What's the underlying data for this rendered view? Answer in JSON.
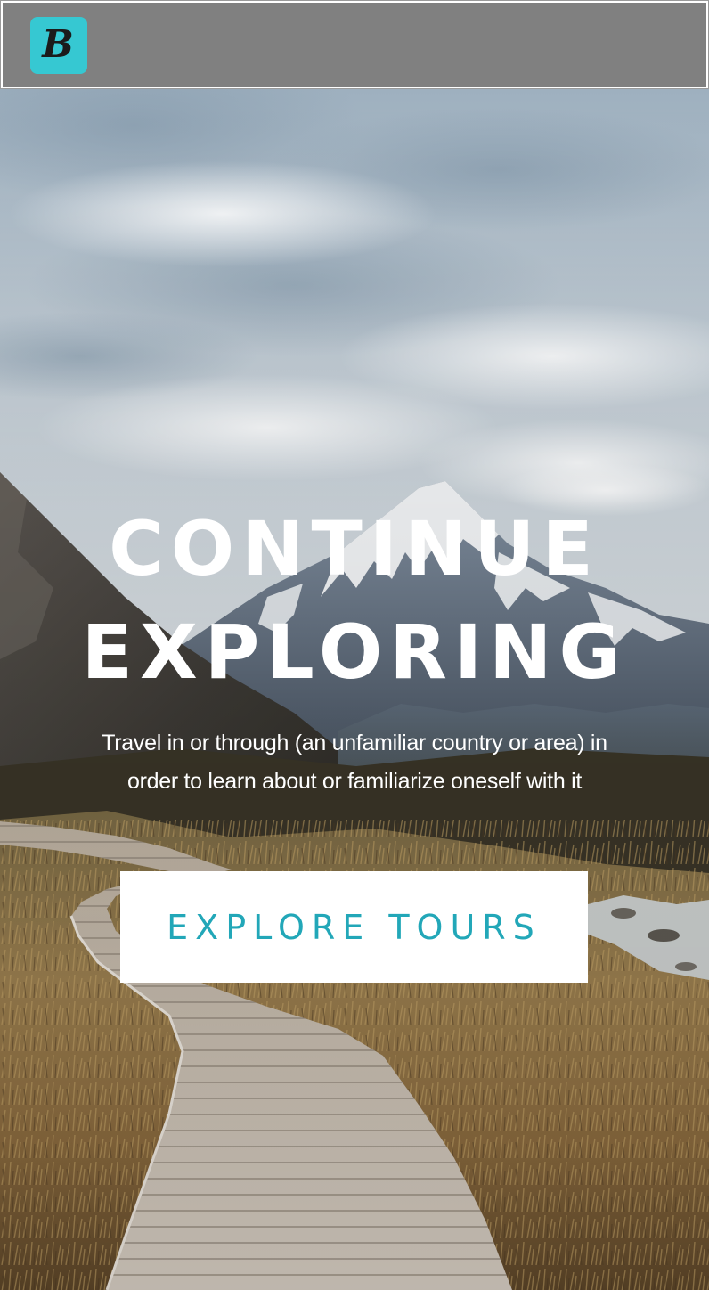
{
  "header": {
    "logo_letter": "B",
    "logo_color": "#36c8d2",
    "background_color": "#808080"
  },
  "hero": {
    "title_line_1": "CONTINUE",
    "title_line_2": "EXPLORING",
    "subtitle": "Travel in or through (an unfamiliar country or area) in order to learn about or familiarize oneself with it",
    "button_label": "EXPLORE TOURS",
    "accent_color": "#22a7b8",
    "background_image": "mountain-boardwalk-landscape"
  }
}
